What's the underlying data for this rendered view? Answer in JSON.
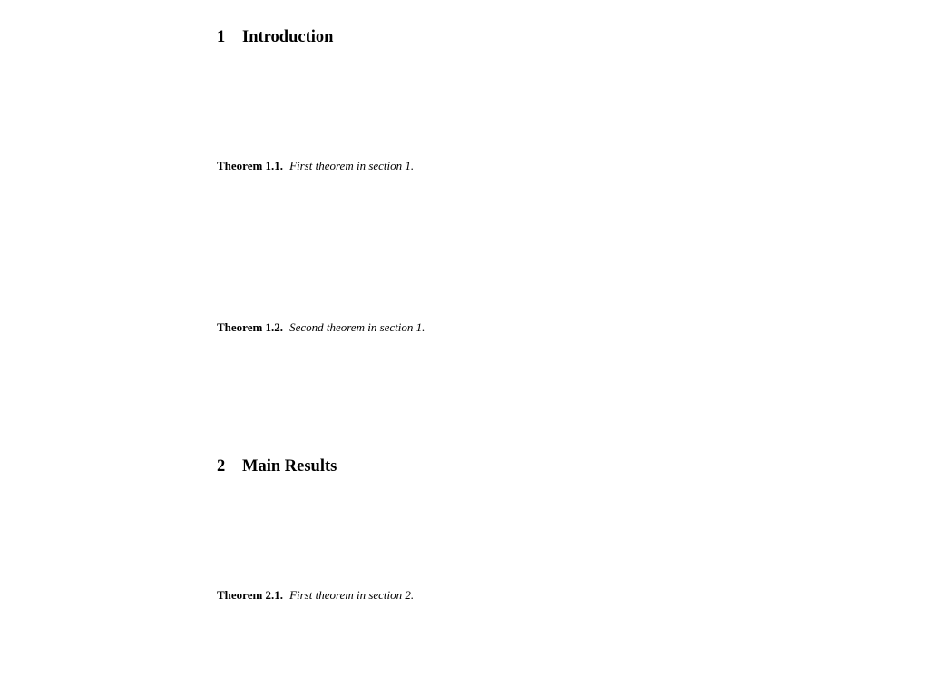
{
  "sections": [
    {
      "number": "1",
      "title": "Introduction",
      "theorems": [
        {
          "label": "Theorem 1.1.",
          "text": "First theorem in section 1."
        },
        {
          "label": "Theorem 1.2.",
          "text": "Second theorem in section 1."
        }
      ]
    },
    {
      "number": "2",
      "title": "Main Results",
      "theorems": [
        {
          "label": "Theorem 2.1.",
          "text": "First theorem in section 2."
        }
      ]
    }
  ]
}
